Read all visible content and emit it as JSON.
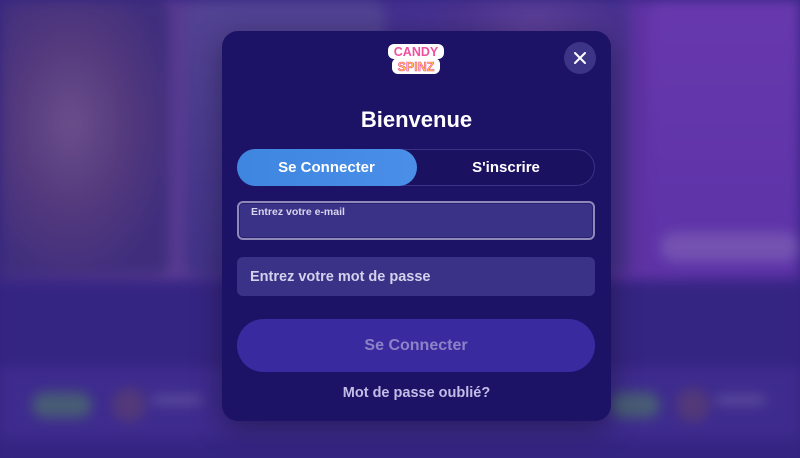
{
  "brand": {
    "logo_line1": "CANDY",
    "logo_line2": "SPINZ",
    "colors": {
      "logo_pink": "#f04fa0",
      "logo_yellow": "#ffd23a",
      "accent_blue": "#3e86e0",
      "modal_bg": "#1c1266"
    }
  },
  "modal": {
    "close_icon": "close-icon",
    "title": "Bienvenue",
    "tabs": [
      {
        "label": "Se Connecter",
        "active": true
      },
      {
        "label": "S'inscrire",
        "active": false
      }
    ],
    "email": {
      "label": "Entrez votre e-mail",
      "value": ""
    },
    "password": {
      "placeholder": "Entrez votre mot de passe",
      "value": ""
    },
    "submit_label": "Se Connecter",
    "forgot_label": "Mot de passe oublié?"
  }
}
